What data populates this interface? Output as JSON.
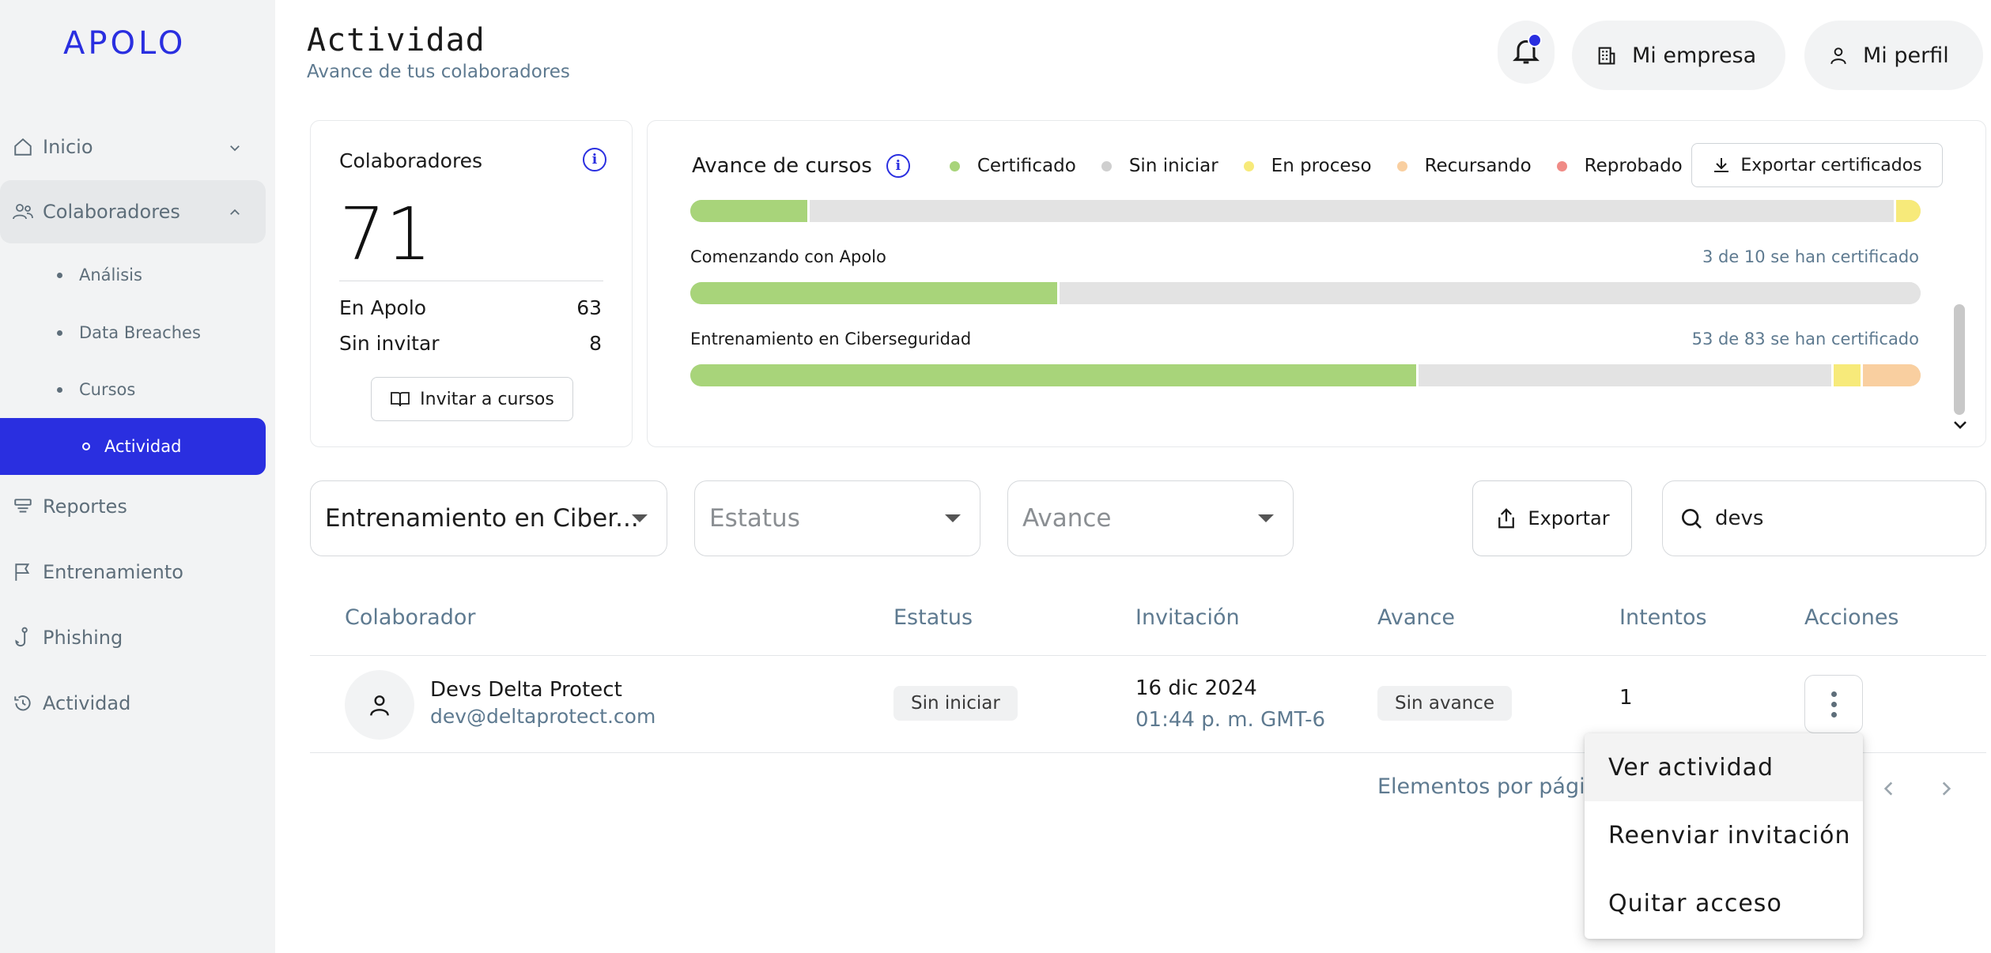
{
  "brand": {
    "logo": "APOLO",
    "accent": "#2a2fe0"
  },
  "sidebar": {
    "items": [
      {
        "label": "Inicio"
      },
      {
        "label": "Colaboradores"
      },
      {
        "label": "Reportes"
      },
      {
        "label": "Entrenamiento"
      },
      {
        "label": "Phishing"
      },
      {
        "label": "Actividad"
      }
    ],
    "subitems": [
      {
        "label": "Análisis"
      },
      {
        "label": "Data Breaches"
      },
      {
        "label": "Cursos"
      },
      {
        "label": "Actividad"
      }
    ]
  },
  "header": {
    "title": "Actividad",
    "subtitle": "Avance de tus colaboradores",
    "company_label": "Mi empresa",
    "profile_label": "Mi perfil"
  },
  "collaborators_card": {
    "title": "Colaboradores",
    "total": "71",
    "in_apolo_label": "En Apolo",
    "in_apolo_value": "63",
    "not_invited_label": "Sin invitar",
    "not_invited_value": "8",
    "invite_button": "Invitar a cursos"
  },
  "progress_card": {
    "title": "Avance de cursos",
    "export_button": "Exportar certificados",
    "legend": [
      {
        "label": "Certificado",
        "color": "#a8d47a"
      },
      {
        "label": "Sin iniciar",
        "color": "#cfcfcf"
      },
      {
        "label": "En proceso",
        "color": "#f7ea7a"
      },
      {
        "label": "Recursando",
        "color": "#f9cfa0"
      },
      {
        "label": "Reprobado",
        "color": "#f08b86"
      }
    ],
    "courses": [
      {
        "name": "",
        "cert_text": "",
        "segments": [
          0.097,
          0.883,
          0.0,
          0.0,
          0.0,
          0.02
        ]
      },
      {
        "name": "Comenzando con Apolo",
        "cert_text": "3 de 10 se han certificado",
        "segments": [
          0.3,
          0.7,
          0,
          0,
          0
        ]
      },
      {
        "name": "Entrenamiento en Ciberseguridad",
        "cert_text": "53 de 83 se han certificado",
        "segments": [
          0.592,
          0.337,
          0.024,
          0.047,
          0
        ]
      }
    ]
  },
  "filters": {
    "course_value": "Entrenamiento en Ciber...",
    "status_placeholder": "Estatus",
    "progress_placeholder": "Avance",
    "export_button": "Exportar",
    "search_value": "devs"
  },
  "table": {
    "headers": [
      "Colaborador",
      "Estatus",
      "Invitación",
      "Avance",
      "Intentos",
      "Acciones"
    ],
    "rows": [
      {
        "name": "Devs Delta Protect",
        "email": "dev@deltaprotect.com",
        "status": "Sin iniciar",
        "invite_date": "16 dic 2024",
        "invite_time": "01:44 p. m. GMT-6",
        "progress": "Sin avance",
        "attempts": "1"
      }
    ]
  },
  "pagination": {
    "label": "Elementos por página"
  },
  "actions_menu": {
    "items": [
      "Ver actividad",
      "Reenviar invitación",
      "Quitar acceso"
    ]
  }
}
